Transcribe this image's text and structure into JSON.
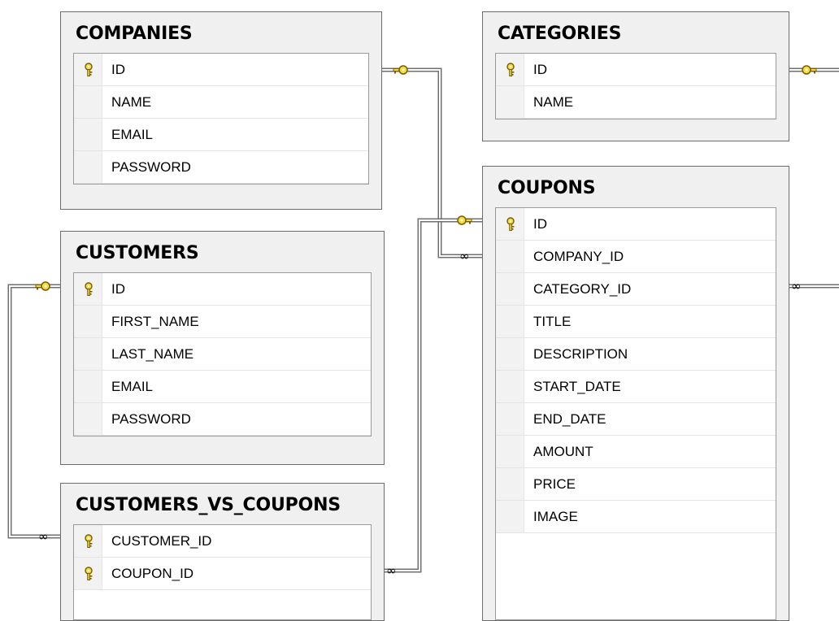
{
  "diagram": {
    "tables": [
      {
        "name": "COMPANIES",
        "columns": [
          {
            "name": "ID",
            "key": true
          },
          {
            "name": "NAME",
            "key": false
          },
          {
            "name": "EMAIL",
            "key": false
          },
          {
            "name": "PASSWORD",
            "key": false
          }
        ]
      },
      {
        "name": "CATEGORIES",
        "columns": [
          {
            "name": "ID",
            "key": true
          },
          {
            "name": "NAME",
            "key": false
          }
        ]
      },
      {
        "name": "CUSTOMERS",
        "columns": [
          {
            "name": "ID",
            "key": true
          },
          {
            "name": "FIRST_NAME",
            "key": false
          },
          {
            "name": "LAST_NAME",
            "key": false
          },
          {
            "name": "EMAIL",
            "key": false
          },
          {
            "name": "PASSWORD",
            "key": false
          }
        ]
      },
      {
        "name": "COUPONS",
        "columns": [
          {
            "name": "ID",
            "key": true
          },
          {
            "name": "COMPANY_ID",
            "key": false
          },
          {
            "name": "CATEGORY_ID",
            "key": false
          },
          {
            "name": "TITLE",
            "key": false
          },
          {
            "name": "DESCRIPTION",
            "key": false
          },
          {
            "name": "START_DATE",
            "key": false
          },
          {
            "name": "END_DATE",
            "key": false
          },
          {
            "name": "AMOUNT",
            "key": false
          },
          {
            "name": "PRICE",
            "key": false
          },
          {
            "name": "IMAGE",
            "key": false
          }
        ]
      },
      {
        "name": "CUSTOMERS_VS_COUPONS",
        "columns": [
          {
            "name": "CUSTOMER_ID",
            "key": true
          },
          {
            "name": "COUPON_ID",
            "key": true
          }
        ]
      }
    ],
    "relationships": [
      {
        "from": "COMPANIES.ID",
        "to": "COUPONS.COMPANY_ID",
        "one_end": "key-icon",
        "many_end": "infinity-icon"
      },
      {
        "from": "CATEGORIES.ID",
        "to": "COUPONS.CATEGORY_ID",
        "one_end": "key-icon",
        "many_end": "infinity-icon"
      },
      {
        "from": "CUSTOMERS.ID",
        "to": "CUSTOMERS_VS_COUPONS.CUSTOMER_ID",
        "one_end": "key-icon",
        "many_end": "infinity-icon"
      },
      {
        "from": "COUPONS.ID",
        "to": "CUSTOMERS_VS_COUPONS.COUPON_ID",
        "one_end": "key-icon",
        "many_end": "infinity-icon"
      }
    ],
    "colors": {
      "key_fill": "#f4dc3c",
      "key_outline": "#7a5c00",
      "connector": "#707070",
      "table_bg": "#f0f0f0",
      "table_border": "#6d6d6d"
    }
  }
}
